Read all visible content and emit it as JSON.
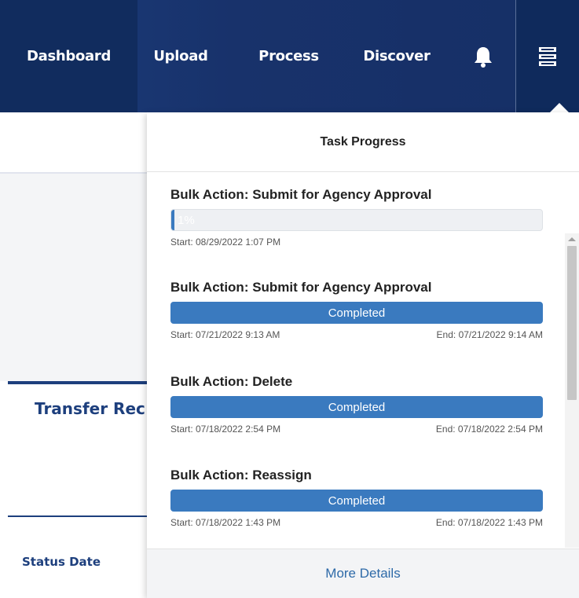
{
  "nav": {
    "dashboard": "Dashboard",
    "upload": "Upload",
    "process": "Process",
    "discover": "Discover",
    "bell_icon": "bell-icon",
    "menu_icon": "server-stack-icon"
  },
  "page": {
    "section_title": "Transfer Rec",
    "column_header": "Status Date"
  },
  "task_panel": {
    "title": "Task Progress",
    "footer_link": "More Details",
    "tasks": [
      {
        "title": "Bulk Action: Submit for Agency Approval",
        "progress_percent": 1,
        "progress_label": "1%",
        "start": "Start: 08/29/2022 1:07 PM",
        "end": ""
      },
      {
        "title": "Bulk Action: Submit for Agency Approval",
        "progress_percent": 100,
        "progress_label": "Completed",
        "start": "Start: 07/21/2022 9:13 AM",
        "end": "End: 07/21/2022 9:14 AM"
      },
      {
        "title": "Bulk Action: Delete",
        "progress_percent": 100,
        "progress_label": "Completed",
        "start": "Start: 07/18/2022 2:54 PM",
        "end": "End: 07/18/2022 2:54 PM"
      },
      {
        "title": "Bulk Action: Reassign",
        "progress_percent": 100,
        "progress_label": "Completed",
        "start": "Start: 07/18/2022 1:43 PM",
        "end": "End: 07/18/2022 1:43 PM"
      }
    ]
  },
  "colors": {
    "nav_bg": "#18326b",
    "progress_blue": "#3a7abf",
    "link_blue": "#2e6aa8",
    "heading_blue": "#1d3f7d"
  }
}
